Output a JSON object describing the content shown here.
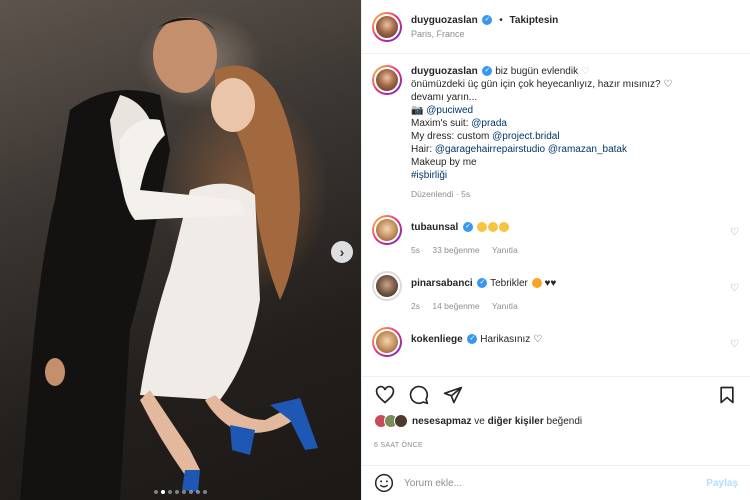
{
  "header": {
    "username": "duyguozaslan",
    "follow_label": "Takiptesin",
    "separator": "•",
    "location": "Paris, France"
  },
  "caption": {
    "username": "duyguozaslan",
    "line1": "biz bugün evlendik",
    "line2": "önümüzdeki üç gün için çok heyecanlıyız, hazır mısınız?",
    "line3": "devamı yarın...",
    "line4_link": "@puciwed",
    "line5_prefix": "Maxim's suit: ",
    "line5_link": "@prada",
    "line6_prefix": "My dress: custom ",
    "line6_link": "@project.bridal",
    "line7_prefix": "Hair: ",
    "line7_link1": "@garagehairrepairstudio",
    "line7_link2": "@ramazan_batak",
    "line8": "Makeup by me",
    "hashtag": "#işbirliği",
    "edited": "Düzenlendi",
    "edited_time": "5s"
  },
  "comments": [
    {
      "username": "tubaunsal",
      "text": "",
      "emoji_note": "clapping-hands x3",
      "time": "5s",
      "likes": "33 beğenme",
      "reply": "Yanıtla"
    },
    {
      "username": "pinarsabanci",
      "text": "Tebrikler",
      "emoji_note": "heart-eyes, black hearts",
      "time": "2s",
      "likes": "14 beğenme",
      "reply": "Yanıtla"
    },
    {
      "username": "kokenliege",
      "text": "Harikasınız",
      "emoji_note": "heart"
    }
  ],
  "likes": {
    "first_liker": "nesesapmaz",
    "connector": " ve ",
    "others": "diğer kişiler",
    "suffix": " beğendi"
  },
  "timestamp": "6 SAAT ÖNCE",
  "add_comment": {
    "placeholder": "Yorum ekle...",
    "post_label": "Paylaş"
  },
  "carousel": {
    "total": 8,
    "active": 2
  },
  "colors": {
    "verified": "#3897f0",
    "link": "#00376b",
    "muted": "#8e8e8e",
    "post_disabled": "#b2dffc"
  },
  "icons": [
    "chevron-right-icon",
    "heart-icon",
    "comment-icon",
    "share-icon",
    "bookmark-icon",
    "emoji-icon",
    "verified-icon"
  ]
}
